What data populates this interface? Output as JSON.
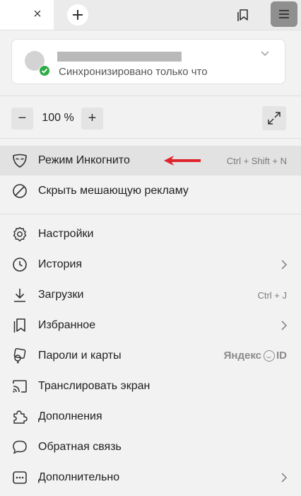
{
  "toolbar": {
    "close_tab_glyph": "×",
    "new_tab_glyph": "+",
    "icons": {
      "close": "close-icon",
      "new_tab": "plus-icon",
      "collections": "collections-icon",
      "menu": "hamburger-menu-icon"
    }
  },
  "profile": {
    "sync_status": "Синхронизировано только что",
    "sync_color": "#2dab45"
  },
  "zoom": {
    "minus": "−",
    "value": "100 %",
    "plus": "+"
  },
  "menu": {
    "incognito": {
      "label": "Режим Инкогнито",
      "shortcut": "Ctrl + Shift + N"
    },
    "block_ads": {
      "label": "Скрыть мешающую рекламу"
    },
    "settings": {
      "label": "Настройки"
    },
    "history": {
      "label": "История"
    },
    "downloads": {
      "label": "Загрузки",
      "shortcut": "Ctrl + J"
    },
    "bookmarks": {
      "label": "Избранное"
    },
    "passwords": {
      "label": "Пароли и карты",
      "badge_prefix": "Яндекс",
      "badge_suffix": "ID"
    },
    "cast": {
      "label": "Транслировать экран"
    },
    "extensions": {
      "label": "Дополнения"
    },
    "feedback": {
      "label": "Обратная связь"
    },
    "more": {
      "label": "Дополнительно"
    }
  },
  "colors": {
    "annotation_arrow": "#e0232d",
    "highlight_row": "#e2e2e2"
  }
}
